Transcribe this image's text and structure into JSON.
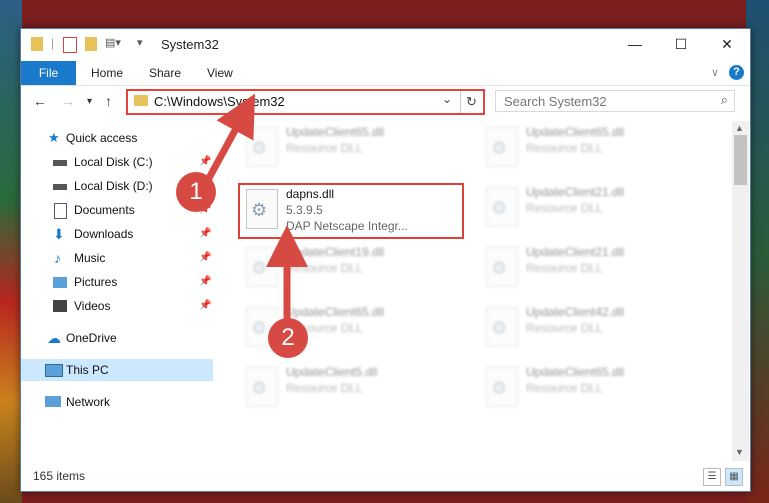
{
  "window": {
    "title": "System32"
  },
  "ribbon": {
    "tabs": [
      "File",
      "Home",
      "Share",
      "View"
    ]
  },
  "address": {
    "path": "C:\\Windows\\System32"
  },
  "search": {
    "placeholder": "Search System32"
  },
  "sidebar": {
    "items": [
      {
        "label": "Quick access",
        "icon": "star-icon"
      },
      {
        "label": "Local Disk (C:)",
        "icon": "drive-icon"
      },
      {
        "label": "Local Disk (D:)",
        "icon": "drive-icon"
      },
      {
        "label": "Documents",
        "icon": "documents-icon"
      },
      {
        "label": "Downloads",
        "icon": "download-icon"
      },
      {
        "label": "Music",
        "icon": "music-icon"
      },
      {
        "label": "Pictures",
        "icon": "pictures-icon"
      },
      {
        "label": "Videos",
        "icon": "videos-icon"
      },
      {
        "label": "OneDrive",
        "icon": "cloud-icon"
      },
      {
        "label": "This PC",
        "icon": "computer-icon"
      },
      {
        "label": "Network",
        "icon": "network-icon"
      }
    ]
  },
  "files": {
    "highlighted": {
      "name": "dapns.dll",
      "version": "5.3.9.5",
      "desc": "DAP Netscape Integr..."
    },
    "others": [
      {
        "name": "UpdateClient65.dll",
        "desc": "Resource DLL"
      },
      {
        "name": "UpdateClient65.dll",
        "desc": "Resource DLL"
      },
      {
        "name": "UpdateClient21.dll",
        "desc": "Resource DLL"
      },
      {
        "name": "UpdateClient19.dll",
        "desc": "Resource DLL"
      },
      {
        "name": "UpdateClient21.dll",
        "desc": "Resource DLL"
      },
      {
        "name": "UpdateClient65.dll",
        "desc": "Resource DLL"
      },
      {
        "name": "UpdateClient42.dll",
        "desc": "Resource DLL"
      },
      {
        "name": "UpdateClient5.dll",
        "desc": "Resource DLL"
      },
      {
        "name": "UpdateClient65.dll",
        "desc": "Resource DLL"
      }
    ]
  },
  "status": {
    "count": "165 items"
  },
  "annotations": {
    "step1": "1",
    "step2": "2",
    "color": "#d74a44"
  }
}
